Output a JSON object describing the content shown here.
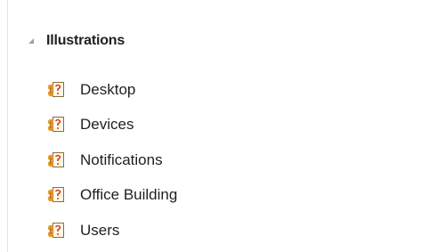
{
  "group": {
    "label": "Illustrations",
    "expanded": true,
    "expander_icon": "triangle-expanded-icon"
  },
  "items": [
    {
      "label": "Desktop",
      "icon": "element-stereotype-icon"
    },
    {
      "label": "Devices",
      "icon": "element-stereotype-icon"
    },
    {
      "label": "Notifications",
      "icon": "element-stereotype-icon"
    },
    {
      "label": "Office Building",
      "icon": "element-stereotype-icon"
    },
    {
      "label": "Users",
      "icon": "element-stereotype-icon"
    }
  ],
  "colors": {
    "text": "#1f1f1f",
    "icon_orange": "#e8962a",
    "icon_red": "#d9342b",
    "icon_page": "#fffbe6",
    "expander": "#a0a0a0"
  }
}
